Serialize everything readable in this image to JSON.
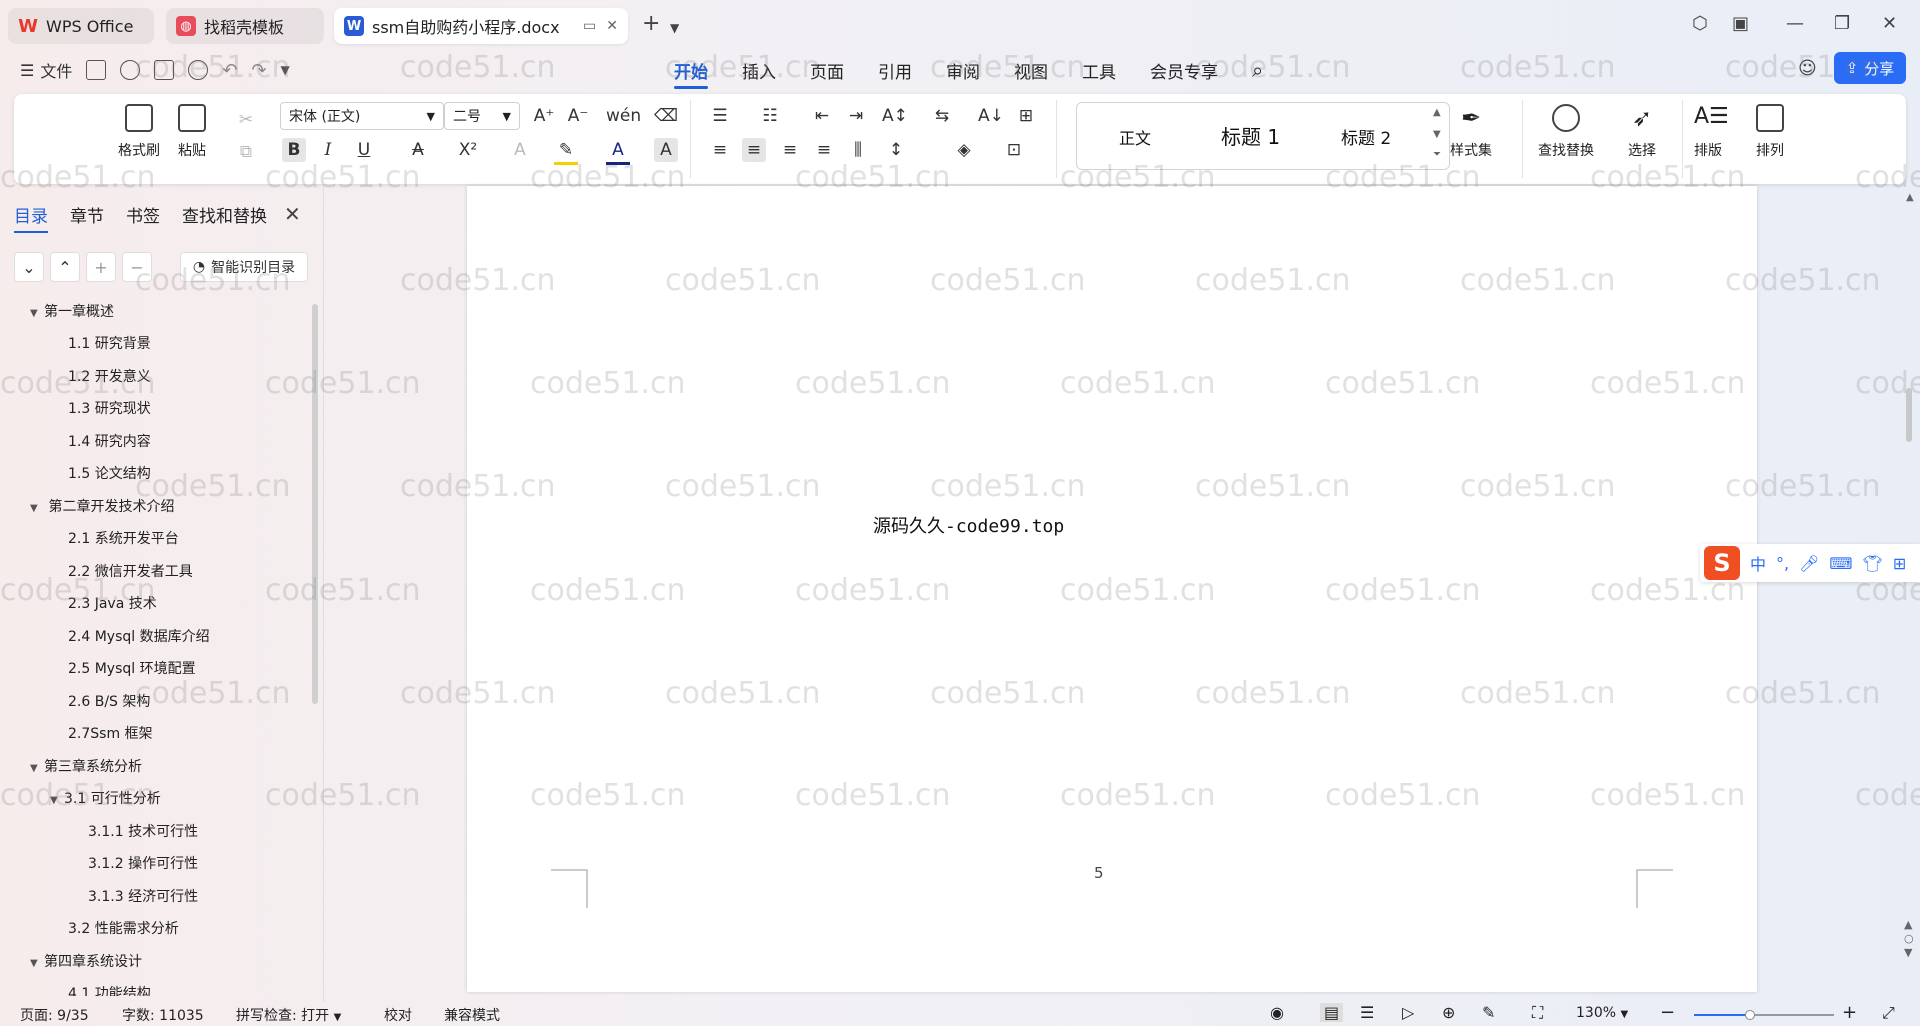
{
  "titlebar": {
    "tabs": [
      {
        "label": "WPS Office",
        "state": "inactive",
        "logo": "wps-logo-icon",
        "color": "#e8392b"
      },
      {
        "label": "找稻壳模板",
        "state": "inactive",
        "logo": "docer-logo-icon",
        "color": "#e84b5a"
      },
      {
        "label": "ssm自助购药小程序.docx",
        "state": "active",
        "logo": "word-doc-icon",
        "color": "#2a5bd7"
      }
    ],
    "new_tab_icon": "plus-icon",
    "window_controls": [
      "minimize-icon",
      "restore-icon",
      "close-icon"
    ]
  },
  "menubar": {
    "file_label": "文件",
    "tabs": [
      "开始",
      "插入",
      "页面",
      "引用",
      "审阅",
      "视图",
      "工具",
      "会员专享"
    ],
    "active_tab": "开始",
    "share_label": "分享",
    "accent": "#1f5fd8"
  },
  "ribbon": {
    "format_painter": "格式刷",
    "paste": "粘贴",
    "font_name": "宋体 (正文)",
    "font_size": "二号",
    "styles": [
      "正文",
      "标题 1",
      "标题 2"
    ],
    "style_set": "样式集",
    "find_replace": "查找替换",
    "select": "选择",
    "layout": "排版",
    "arrange": "排列",
    "bold": "B",
    "italic": "I",
    "underline": "U"
  },
  "navpane": {
    "tabs": [
      "目录",
      "章节",
      "书签",
      "查找和替换"
    ],
    "active_tab": "目录",
    "smart_toc": "智能识别目录",
    "toc": [
      {
        "label": "第一章概述",
        "level": 1,
        "expanded": true
      },
      {
        "label": "1.1 研究背景",
        "level": 2
      },
      {
        "label": "1.2 开发意义",
        "level": 2
      },
      {
        "label": "1.3  研究现状",
        "level": 2
      },
      {
        "label": "1.4  研究内容",
        "level": 2
      },
      {
        "label": "1.5 论文结构",
        "level": 2
      },
      {
        "label": " 第二章开发技术介绍",
        "level": 1,
        "expanded": true
      },
      {
        "label": "2.1  系统开发平台",
        "level": 2
      },
      {
        "label": "2.2 微信开发者工具",
        "level": 2
      },
      {
        "label": "2.3 Java 技术",
        "level": 2
      },
      {
        "label": "2.4 Mysql 数据库介绍",
        "level": 2
      },
      {
        "label": "2.5 Mysql 环境配置",
        "level": 2
      },
      {
        "label": "2.6 B/S 架构",
        "level": 2
      },
      {
        "label": "2.7Ssm 框架",
        "level": 2
      },
      {
        "label": "第三章系统分析",
        "level": 1,
        "expanded": true
      },
      {
        "label": "3.1  可行性分析",
        "level": 2,
        "expanded": true
      },
      {
        "label": "3.1.1 技术可行性",
        "level": 3
      },
      {
        "label": "3.1.2 操作可行性",
        "level": 3
      },
      {
        "label": "3.1.3 经济可行性",
        "level": 3
      },
      {
        "label": "3.2 性能需求分析",
        "level": 2
      },
      {
        "label": "第四章系统设计",
        "level": 1,
        "expanded": true
      },
      {
        "label": "4.1 功能结构",
        "level": 2
      }
    ]
  },
  "document": {
    "body_text": "源码久久-code99.top",
    "page_number": "5",
    "watermark": "code51.cn"
  },
  "ime": {
    "logo": "S",
    "mode": "中"
  },
  "statusbar": {
    "page": "页面: 9/35",
    "words": "字数: 11035",
    "spell": "拼写检查: 打开",
    "proof": "校对",
    "compat": "兼容模式",
    "zoom": "130%",
    "zoom_level_percent": 40
  }
}
